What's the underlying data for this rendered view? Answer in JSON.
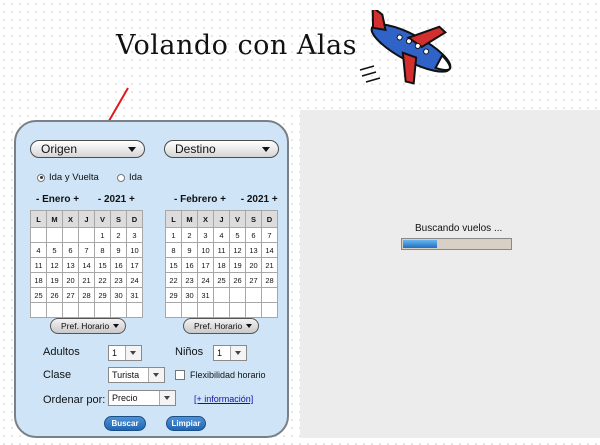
{
  "header": {
    "title": "Volando con Alas"
  },
  "form": {
    "origin_label": "Origen",
    "destination_label": "Destino",
    "trip_type": [
      {
        "label": "Ida y Vuelta",
        "selected": true
      },
      {
        "label": "Ida",
        "selected": false
      }
    ],
    "calendars": [
      {
        "month_nav": "- Enero +",
        "year_nav": "- 2021 +",
        "days": [
          "L",
          "M",
          "X",
          "J",
          "V",
          "S",
          "D"
        ],
        "weeks": [
          [
            "",
            "",
            "",
            "",
            "1",
            "2",
            "3"
          ],
          [
            "4",
            "5",
            "6",
            "7",
            "8",
            "9",
            "10"
          ],
          [
            "11",
            "12",
            "13",
            "14",
            "15",
            "16",
            "17"
          ],
          [
            "18",
            "19",
            "20",
            "21",
            "22",
            "23",
            "24"
          ],
          [
            "25",
            "26",
            "27",
            "28",
            "29",
            "30",
            "31"
          ],
          [
            "",
            "",
            "",
            "",
            "",
            "",
            ""
          ]
        ]
      },
      {
        "month_nav": "- Febrero +",
        "year_nav": "- 2021 +",
        "days": [
          "L",
          "M",
          "X",
          "J",
          "V",
          "S",
          "D"
        ],
        "weeks": [
          [
            "1",
            "2",
            "3",
            "4",
            "5",
            "6",
            "7"
          ],
          [
            "8",
            "9",
            "10",
            "11",
            "12",
            "13",
            "14"
          ],
          [
            "15",
            "16",
            "17",
            "18",
            "19",
            "20",
            "21"
          ],
          [
            "22",
            "23",
            "24",
            "25",
            "26",
            "27",
            "28"
          ],
          [
            "29",
            "30",
            "31",
            "",
            "",
            "",
            ""
          ],
          [
            "",
            "",
            "",
            "",
            "",
            "",
            ""
          ]
        ]
      }
    ],
    "pref_horario_label": "Pref. Horario",
    "adults_label": "Adultos",
    "adults_value": "1",
    "children_label": "Niños",
    "children_value": "1",
    "class_label": "Clase",
    "class_value": "Turista",
    "flexibility_label": "Flexibilidad horario",
    "sort_label": "Ordenar por:",
    "sort_value": "Precio",
    "more_info_link": "[+ información]",
    "search_button": "Buscar",
    "clear_button": "Limpiar"
  },
  "results": {
    "status_text": "Buscando vuelos ...",
    "progress": 0.33
  }
}
